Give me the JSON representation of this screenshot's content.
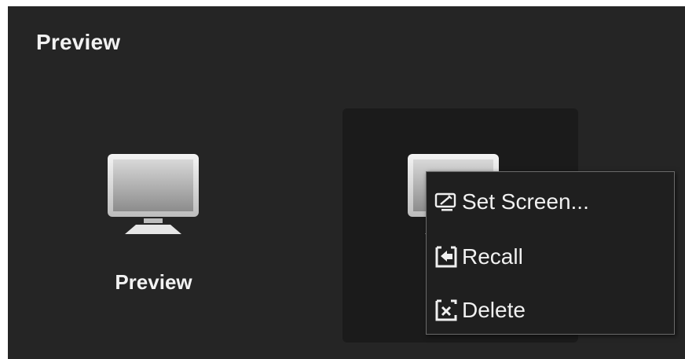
{
  "panel": {
    "title": "Preview"
  },
  "tiles": [
    {
      "label": "Preview",
      "icon": "monitor-icon"
    },
    {
      "label": "",
      "icon": "monitor-icon"
    }
  ],
  "context_menu": {
    "items": [
      {
        "label": "Set Screen...",
        "icon": "set-screen-icon"
      },
      {
        "label": "Recall",
        "icon": "recall-icon"
      },
      {
        "label": "Delete",
        "icon": "delete-icon"
      }
    ]
  }
}
